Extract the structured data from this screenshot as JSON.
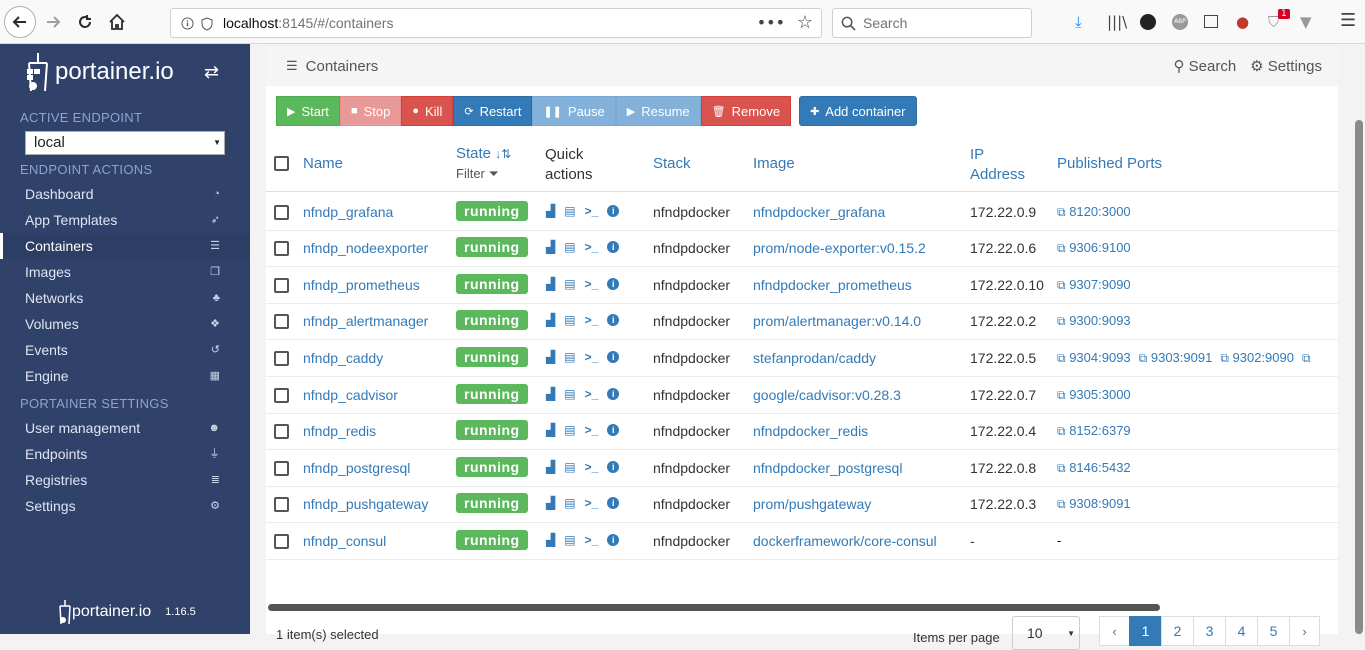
{
  "browser": {
    "url_host": "localhost",
    "url_rest": ":8145/#/containers",
    "search_placeholder": "Search",
    "badge_count": "1"
  },
  "sidebar": {
    "brand": "portainer.io",
    "active_endpoint_title": "ACTIVE ENDPOINT",
    "endpoint_value": "local",
    "endpoint_actions_title": "ENDPOINT ACTIONS",
    "items": [
      {
        "label": "Dashboard",
        "icon": "tachometer-icon"
      },
      {
        "label": "App Templates",
        "icon": "rocket-icon"
      },
      {
        "label": "Containers",
        "icon": "server-icon"
      },
      {
        "label": "Images",
        "icon": "clone-icon"
      },
      {
        "label": "Networks",
        "icon": "sitemap-icon"
      },
      {
        "label": "Volumes",
        "icon": "cubes-icon"
      },
      {
        "label": "Events",
        "icon": "history-icon"
      },
      {
        "label": "Engine",
        "icon": "th-icon"
      }
    ],
    "settings_title": "PORTAINER SETTINGS",
    "settings_items": [
      {
        "label": "User management",
        "icon": "users-icon"
      },
      {
        "label": "Endpoints",
        "icon": "plug-icon"
      },
      {
        "label": "Registries",
        "icon": "database-icon"
      },
      {
        "label": "Settings",
        "icon": "cogs-icon"
      }
    ],
    "footer_brand": "portainer.io",
    "version": "1.16.5"
  },
  "header": {
    "title": "Containers",
    "search_label": "Search",
    "settings_label": "Settings"
  },
  "actions": {
    "start": "Start",
    "stop": "Stop",
    "kill": "Kill",
    "restart": "Restart",
    "pause": "Pause",
    "resume": "Resume",
    "remove": "Remove",
    "add": "Add container"
  },
  "table": {
    "headers": {
      "name": "Name",
      "state": "State",
      "filter": "Filter",
      "quick_actions_1": "Quick",
      "quick_actions_2": "actions",
      "stack": "Stack",
      "image": "Image",
      "ip_1": "IP",
      "ip_2": "Address",
      "ports": "Published Ports"
    },
    "rows": [
      {
        "name": "nfndp_grafana",
        "state": "running",
        "stack": "nfndpdocker",
        "image": "nfndpdocker_grafana",
        "ip": "172.22.0.9",
        "ports": [
          "8120:3000"
        ]
      },
      {
        "name": "nfndp_nodeexporter",
        "state": "running",
        "stack": "nfndpdocker",
        "image": "prom/node-exporter:v0.15.2",
        "ip": "172.22.0.6",
        "ports": [
          "9306:9100"
        ]
      },
      {
        "name": "nfndp_prometheus",
        "state": "running",
        "stack": "nfndpdocker",
        "image": "nfndpdocker_prometheus",
        "ip": "172.22.0.10",
        "ports": [
          "9307:9090"
        ]
      },
      {
        "name": "nfndp_alertmanager",
        "state": "running",
        "stack": "nfndpdocker",
        "image": "prom/alertmanager:v0.14.0",
        "ip": "172.22.0.2",
        "ports": [
          "9300:9093"
        ]
      },
      {
        "name": "nfndp_caddy",
        "state": "running",
        "stack": "nfndpdocker",
        "image": "stefanprodan/caddy",
        "ip": "172.22.0.5",
        "ports": [
          "9304:9093",
          "9303:9091",
          "9302:9090",
          ""
        ]
      },
      {
        "name": "nfndp_cadvisor",
        "state": "running",
        "stack": "nfndpdocker",
        "image": "google/cadvisor:v0.28.3",
        "ip": "172.22.0.7",
        "ports": [
          "9305:3000"
        ]
      },
      {
        "name": "nfndp_redis",
        "state": "running",
        "stack": "nfndpdocker",
        "image": "nfndpdocker_redis",
        "ip": "172.22.0.4",
        "ports": [
          "8152:6379"
        ]
      },
      {
        "name": "nfndp_postgresql",
        "state": "running",
        "stack": "nfndpdocker",
        "image": "nfndpdocker_postgresql",
        "ip": "172.22.0.8",
        "ports": [
          "8146:5432"
        ]
      },
      {
        "name": "nfndp_pushgateway",
        "state": "running",
        "stack": "nfndpdocker",
        "image": "prom/pushgateway",
        "ip": "172.22.0.3",
        "ports": [
          "9308:9091"
        ]
      },
      {
        "name": "nfndp_consul",
        "state": "running",
        "stack": "nfndpdocker",
        "image": "dockerframework/core-consul",
        "ip": "-",
        "ports": []
      }
    ],
    "empty_port": "-"
  },
  "footer": {
    "selected_info": "1 item(s) selected",
    "items_per_page_label": "Items per page",
    "items_per_page_value": "10",
    "pages": [
      "1",
      "2",
      "3",
      "4",
      "5"
    ],
    "current_page": "1",
    "prev": "‹",
    "next": "›"
  },
  "colors": {
    "sidebar_bg": "#30426a",
    "running": "#5cb85c",
    "link": "#337ab7"
  }
}
